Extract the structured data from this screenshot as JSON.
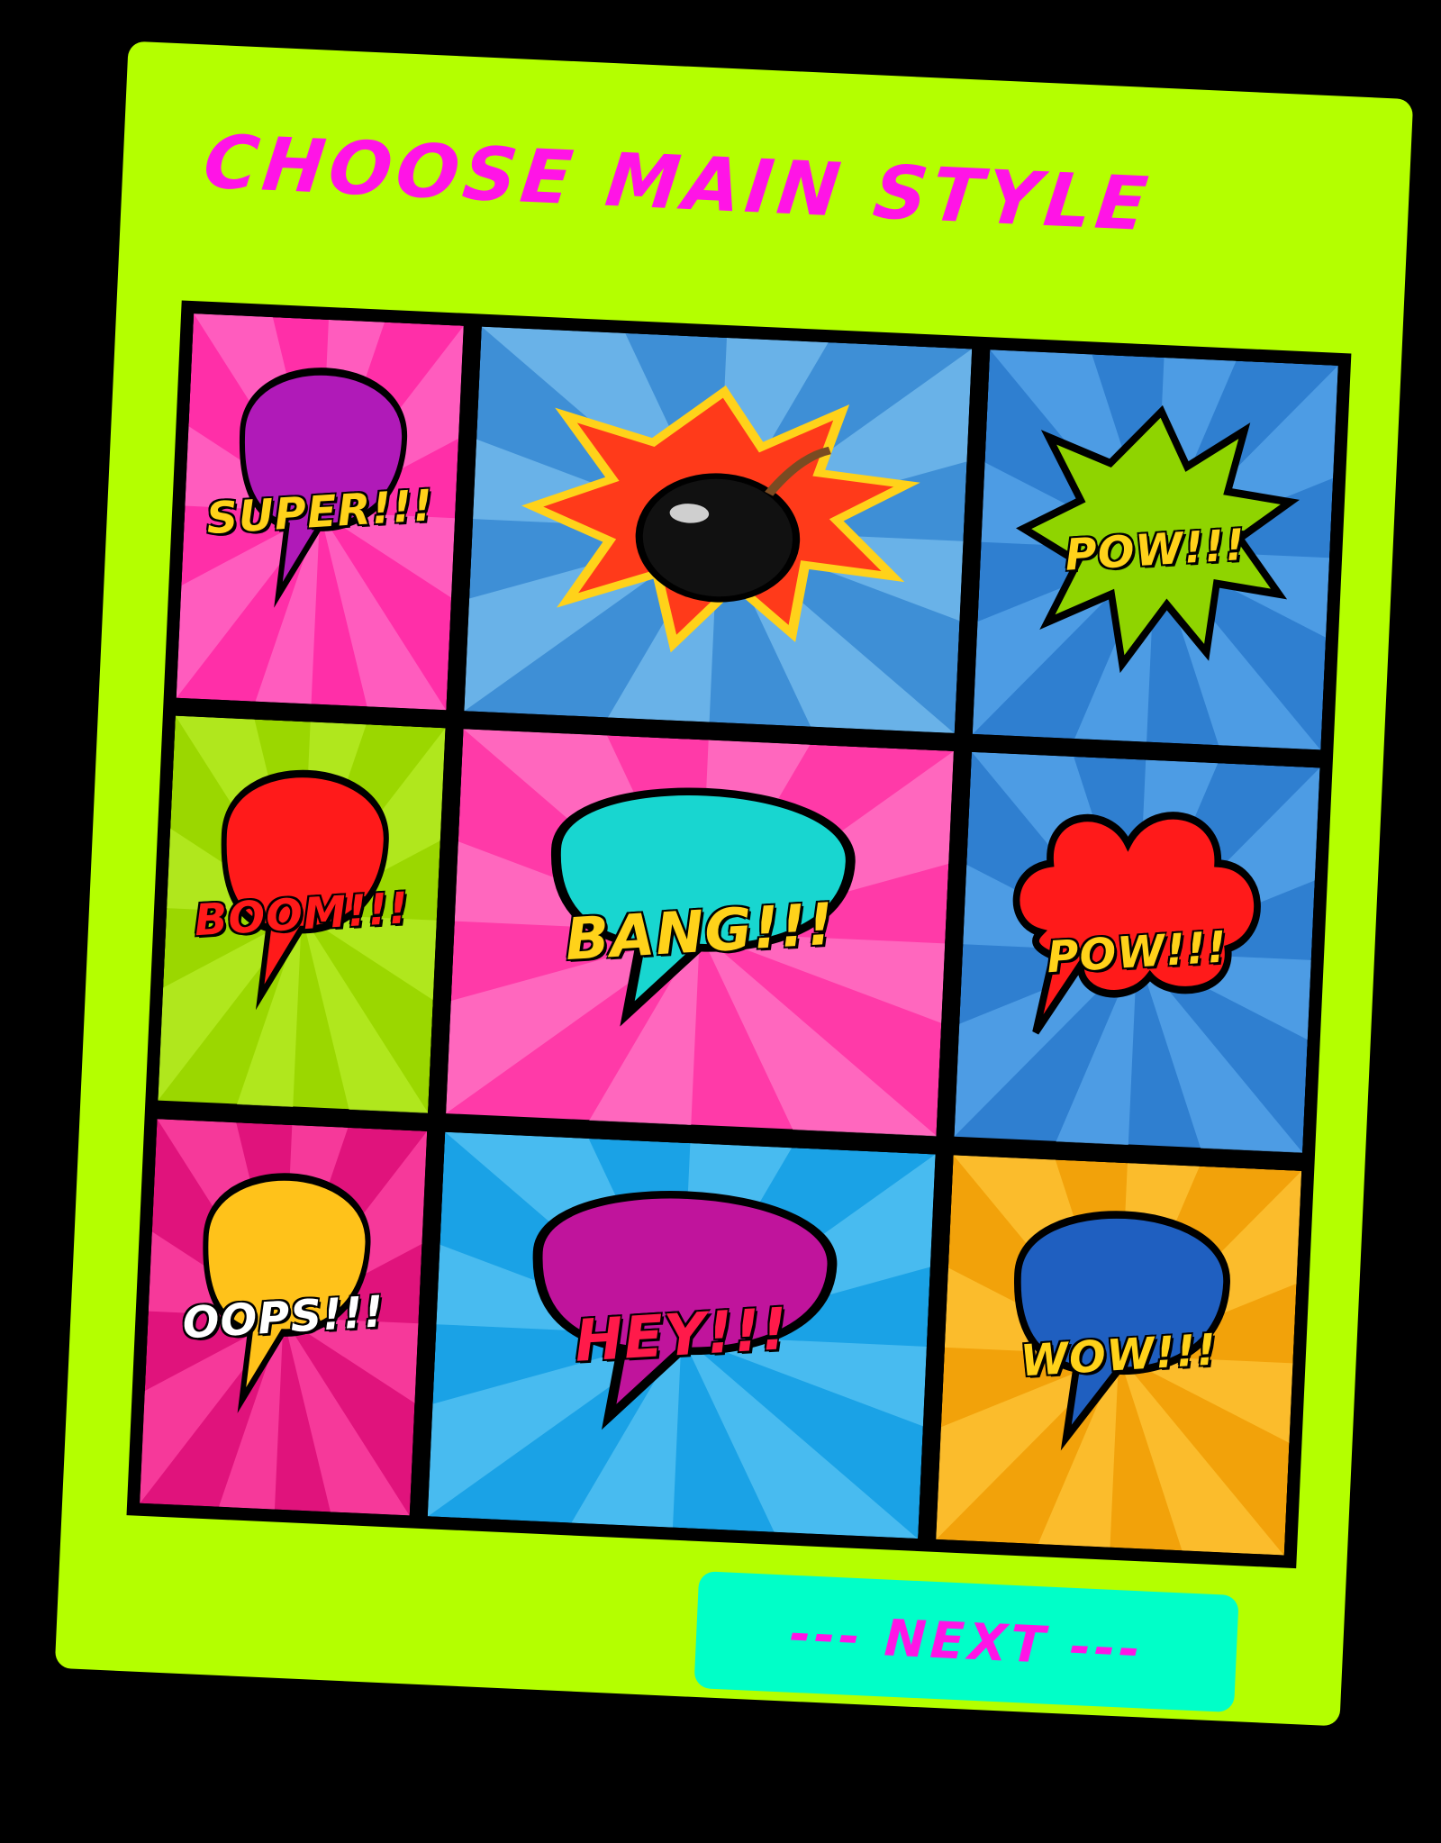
{
  "screen": {
    "title": "CHOOSE MAIN STYLE",
    "next_label": "--- NEXT ---"
  },
  "colors": {
    "card": "#b4ff00",
    "accent": "#ff14e6",
    "button": "#00ffc8",
    "backdrop": "#000000"
  },
  "panels": [
    {
      "name": "super",
      "text": "SUPER!!!",
      "bg": "#ff2fa8",
      "ray": "#ff6fc8",
      "bubble": "#b01ab8",
      "text_color": "#ffd21a",
      "icon": "speech-bubble-icon"
    },
    {
      "name": "bomb",
      "text": "",
      "bg": "#3e8fd6",
      "ray": "#7cc0f0",
      "bubble": "#ff3a1a",
      "text_color": "#ffd21a",
      "icon": "bomb-icon"
    },
    {
      "name": "pow-splash",
      "text": "POW!!!",
      "bg": "#2f7fd0",
      "ray": "#5aa8ec",
      "bubble": "#8fd400",
      "text_color": "#ffd21a",
      "icon": "splash-icon"
    },
    {
      "name": "boom",
      "text": "BOOM!!!",
      "bg": "#9bd700",
      "ray": "#b9ee2a",
      "bubble": "#ff1a1a",
      "text_color": "#ff1a1a",
      "icon": "speech-bubble-icon"
    },
    {
      "name": "bang",
      "text": "BANG!!!",
      "bg": "#ff3aa8",
      "ray": "#ff7ac8",
      "bubble": "#18d6d0",
      "text_color": "#ffd21a",
      "icon": "speech-bubble-icon"
    },
    {
      "name": "pow-cloud",
      "text": "POW!!!",
      "bg": "#2f7fd0",
      "ray": "#5aa8ec",
      "bubble": "#ff1a1a",
      "text_color": "#ffd21a",
      "icon": "cloud-bubble-icon"
    },
    {
      "name": "oops",
      "text": "OOPS!!!",
      "bg": "#e0137c",
      "ray": "#ff4aa6",
      "bubble": "#ffc21a",
      "text_color": "#ffffff",
      "icon": "speech-bubble-icon"
    },
    {
      "name": "hey",
      "text": "HEY!!!",
      "bg": "#1aa2e6",
      "ray": "#5cc6f4",
      "bubble": "#c0149c",
      "text_color": "#ff1a4a",
      "icon": "speech-bubble-icon"
    },
    {
      "name": "wow",
      "text": "WOW!!!",
      "bg": "#f2a20a",
      "ray": "#ffc83a",
      "bubble": "#1f5fc0",
      "text_color": "#ffd21a",
      "icon": "speech-bubble-icon"
    }
  ]
}
